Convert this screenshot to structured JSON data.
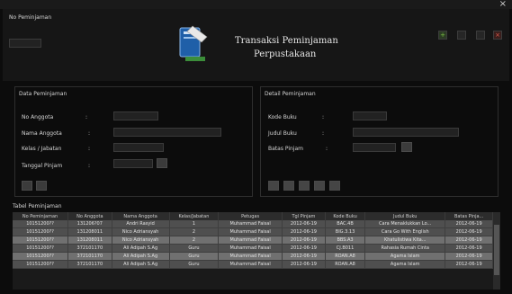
{
  "window": {
    "close_glyph": "×"
  },
  "header": {
    "no_label": "No Peminjaman",
    "no_value": "",
    "title_line1": "Transaksi Peminjaman",
    "title_line2": "Perpustakaan",
    "icon": "books-icon",
    "actions": [
      {
        "name": "add-icon",
        "glyph": "+",
        "color": "#6ab04c"
      },
      {
        "name": "edit-icon",
        "glyph": "",
        "color": "#555555"
      },
      {
        "name": "save-icon",
        "glyph": "",
        "color": "#555555"
      },
      {
        "name": "delete-icon",
        "glyph": "×",
        "color": "#c0392b"
      }
    ]
  },
  "data_peminjam": {
    "title": "Data Peminjaman",
    "fields": [
      {
        "label": "No Anggota",
        "sep": ":",
        "value": ""
      },
      {
        "label": "Nama Anggota",
        "sep": ":",
        "value": ""
      },
      {
        "label": "Kelas / Jabatan",
        "sep": ":",
        "value": ""
      },
      {
        "label": "Tanggal Pinjam",
        "sep": ":",
        "value": ""
      }
    ]
  },
  "detail_peminjaman": {
    "title": "Detail Peminjaman",
    "fields": [
      {
        "label": "Kode Buku",
        "sep": ":",
        "value": ""
      },
      {
        "label": "Judul Buku",
        "sep": ":",
        "value": ""
      },
      {
        "label": "Batas Pinjam",
        "sep": ":",
        "value": ""
      }
    ]
  },
  "table": {
    "title": "Tabel Peminjaman",
    "columns": [
      "No Peminjaman",
      "No Anggota",
      "Nama Anggota",
      "Kelas/Jabatan",
      "Petugas",
      "Tgl Pinjam",
      "Kode Buku",
      "Judul Buku",
      "Batas Pinja..."
    ],
    "rows": [
      [
        "10151200??",
        "131206?07",
        "Andri Rasyid",
        "1",
        "Muhammad Faisal",
        "2012-06-19",
        "BAC.4B",
        "Cara Menaklukkan Lo...",
        "2012-06-19"
      ],
      [
        "10151200??",
        "131208011",
        "Nico Adriansyah",
        "2",
        "Muhammad Faisal",
        "2012-06-19",
        "BIG.3.13",
        "Cara Go With English",
        "2012-06-19"
      ],
      [
        "10151200??",
        "131208011",
        "Nico Adriansyah",
        "2",
        "Muhammad Faisal",
        "2012-06-19",
        "BBS.A3",
        "Khatulistiwa Kita...",
        "2012-06-19"
      ],
      [
        "10151200??",
        "372101170",
        "Ali Adipah S.Ag",
        "Guru",
        "Muhammad Faisal",
        "2012-06-19",
        "CJ.B011",
        "Rahasia Rumah Cinta",
        "2012-06-19"
      ],
      [
        "10151200??",
        "372101170",
        "Ali Adipah S.Ag",
        "Guru",
        "Muhammad Faisal",
        "2012-06-19",
        "ROAN.A8",
        "Agama Islam",
        "2012-06-19"
      ],
      [
        "10151200??",
        "372101170",
        "Ali Adipah S.Ag",
        "Guru",
        "Muhammad Faisal",
        "2012-06-19",
        "ROAN.A8",
        "Agama Islam",
        "2012-06-19"
      ]
    ]
  }
}
